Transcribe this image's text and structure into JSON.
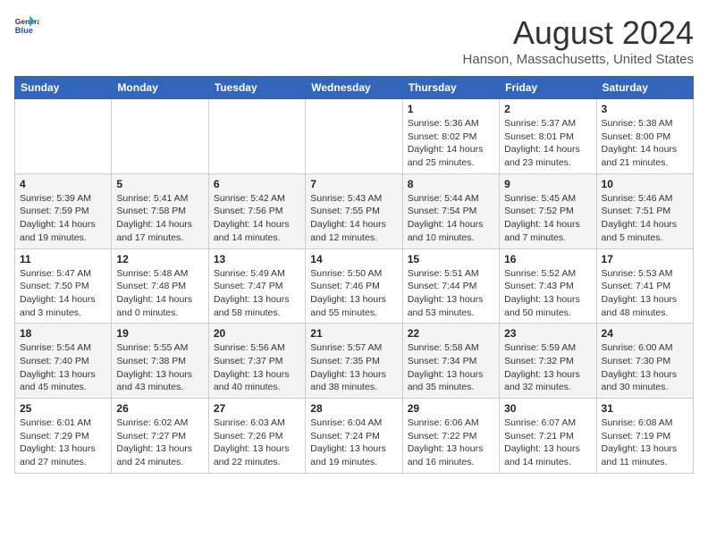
{
  "logo": {
    "text_general": "General",
    "text_blue": "Blue"
  },
  "title": {
    "month_year": "August 2024",
    "location": "Hanson, Massachusetts, United States"
  },
  "days_of_week": [
    "Sunday",
    "Monday",
    "Tuesday",
    "Wednesday",
    "Thursday",
    "Friday",
    "Saturday"
  ],
  "weeks": [
    [
      {
        "day": "",
        "info": ""
      },
      {
        "day": "",
        "info": ""
      },
      {
        "day": "",
        "info": ""
      },
      {
        "day": "",
        "info": ""
      },
      {
        "day": "1",
        "info": "Sunrise: 5:36 AM\nSunset: 8:02 PM\nDaylight: 14 hours\nand 25 minutes."
      },
      {
        "day": "2",
        "info": "Sunrise: 5:37 AM\nSunset: 8:01 PM\nDaylight: 14 hours\nand 23 minutes."
      },
      {
        "day": "3",
        "info": "Sunrise: 5:38 AM\nSunset: 8:00 PM\nDaylight: 14 hours\nand 21 minutes."
      }
    ],
    [
      {
        "day": "4",
        "info": "Sunrise: 5:39 AM\nSunset: 7:59 PM\nDaylight: 14 hours\nand 19 minutes."
      },
      {
        "day": "5",
        "info": "Sunrise: 5:41 AM\nSunset: 7:58 PM\nDaylight: 14 hours\nand 17 minutes."
      },
      {
        "day": "6",
        "info": "Sunrise: 5:42 AM\nSunset: 7:56 PM\nDaylight: 14 hours\nand 14 minutes."
      },
      {
        "day": "7",
        "info": "Sunrise: 5:43 AM\nSunset: 7:55 PM\nDaylight: 14 hours\nand 12 minutes."
      },
      {
        "day": "8",
        "info": "Sunrise: 5:44 AM\nSunset: 7:54 PM\nDaylight: 14 hours\nand 10 minutes."
      },
      {
        "day": "9",
        "info": "Sunrise: 5:45 AM\nSunset: 7:52 PM\nDaylight: 14 hours\nand 7 minutes."
      },
      {
        "day": "10",
        "info": "Sunrise: 5:46 AM\nSunset: 7:51 PM\nDaylight: 14 hours\nand 5 minutes."
      }
    ],
    [
      {
        "day": "11",
        "info": "Sunrise: 5:47 AM\nSunset: 7:50 PM\nDaylight: 14 hours\nand 3 minutes."
      },
      {
        "day": "12",
        "info": "Sunrise: 5:48 AM\nSunset: 7:48 PM\nDaylight: 14 hours\nand 0 minutes."
      },
      {
        "day": "13",
        "info": "Sunrise: 5:49 AM\nSunset: 7:47 PM\nDaylight: 13 hours\nand 58 minutes."
      },
      {
        "day": "14",
        "info": "Sunrise: 5:50 AM\nSunset: 7:46 PM\nDaylight: 13 hours\nand 55 minutes."
      },
      {
        "day": "15",
        "info": "Sunrise: 5:51 AM\nSunset: 7:44 PM\nDaylight: 13 hours\nand 53 minutes."
      },
      {
        "day": "16",
        "info": "Sunrise: 5:52 AM\nSunset: 7:43 PM\nDaylight: 13 hours\nand 50 minutes."
      },
      {
        "day": "17",
        "info": "Sunrise: 5:53 AM\nSunset: 7:41 PM\nDaylight: 13 hours\nand 48 minutes."
      }
    ],
    [
      {
        "day": "18",
        "info": "Sunrise: 5:54 AM\nSunset: 7:40 PM\nDaylight: 13 hours\nand 45 minutes."
      },
      {
        "day": "19",
        "info": "Sunrise: 5:55 AM\nSunset: 7:38 PM\nDaylight: 13 hours\nand 43 minutes."
      },
      {
        "day": "20",
        "info": "Sunrise: 5:56 AM\nSunset: 7:37 PM\nDaylight: 13 hours\nand 40 minutes."
      },
      {
        "day": "21",
        "info": "Sunrise: 5:57 AM\nSunset: 7:35 PM\nDaylight: 13 hours\nand 38 minutes."
      },
      {
        "day": "22",
        "info": "Sunrise: 5:58 AM\nSunset: 7:34 PM\nDaylight: 13 hours\nand 35 minutes."
      },
      {
        "day": "23",
        "info": "Sunrise: 5:59 AM\nSunset: 7:32 PM\nDaylight: 13 hours\nand 32 minutes."
      },
      {
        "day": "24",
        "info": "Sunrise: 6:00 AM\nSunset: 7:30 PM\nDaylight: 13 hours\nand 30 minutes."
      }
    ],
    [
      {
        "day": "25",
        "info": "Sunrise: 6:01 AM\nSunset: 7:29 PM\nDaylight: 13 hours\nand 27 minutes."
      },
      {
        "day": "26",
        "info": "Sunrise: 6:02 AM\nSunset: 7:27 PM\nDaylight: 13 hours\nand 24 minutes."
      },
      {
        "day": "27",
        "info": "Sunrise: 6:03 AM\nSunset: 7:26 PM\nDaylight: 13 hours\nand 22 minutes."
      },
      {
        "day": "28",
        "info": "Sunrise: 6:04 AM\nSunset: 7:24 PM\nDaylight: 13 hours\nand 19 minutes."
      },
      {
        "day": "29",
        "info": "Sunrise: 6:06 AM\nSunset: 7:22 PM\nDaylight: 13 hours\nand 16 minutes."
      },
      {
        "day": "30",
        "info": "Sunrise: 6:07 AM\nSunset: 7:21 PM\nDaylight: 13 hours\nand 14 minutes."
      },
      {
        "day": "31",
        "info": "Sunrise: 6:08 AM\nSunset: 7:19 PM\nDaylight: 13 hours\nand 11 minutes."
      }
    ]
  ]
}
